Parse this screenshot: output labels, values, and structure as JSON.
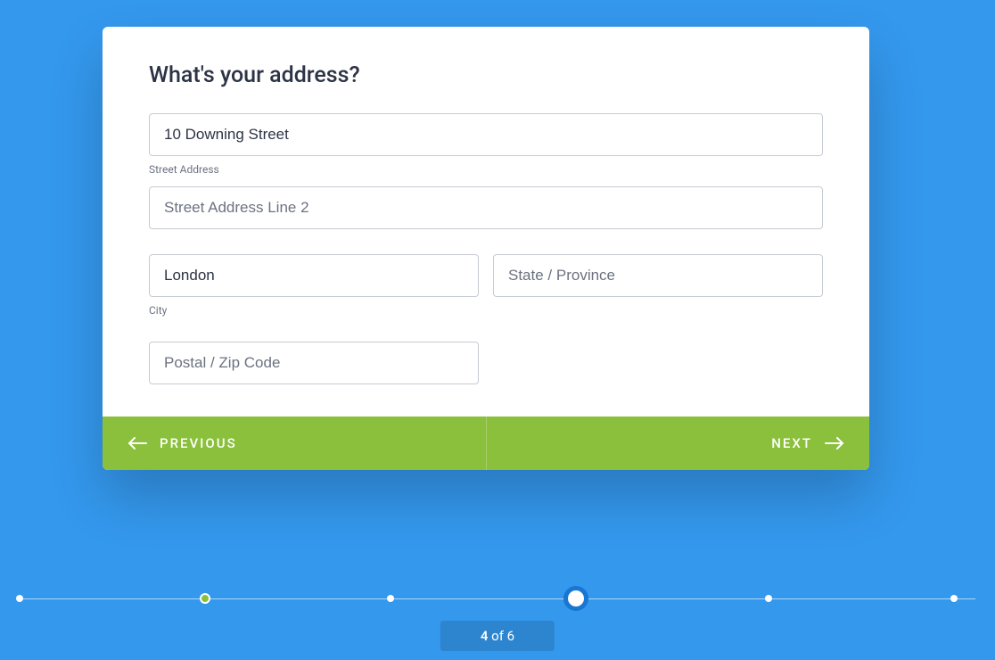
{
  "heading": "What's your address?",
  "fields": {
    "street": {
      "value": "10 Downing Street",
      "sublabel": "Street Address"
    },
    "street2": {
      "placeholder": "Street Address Line 2"
    },
    "city": {
      "value": "London",
      "sublabel": "City"
    },
    "state": {
      "placeholder": "State / Province"
    },
    "postal": {
      "placeholder": "Postal / Zip Code"
    }
  },
  "footer": {
    "previous": "PREVIOUS",
    "next": "NEXT"
  },
  "progress": {
    "current": "4",
    "of_label": " of ",
    "total": "6"
  },
  "colors": {
    "background": "#3498ed",
    "accent": "#8ac03b",
    "current_ring": "#1976d2"
  }
}
